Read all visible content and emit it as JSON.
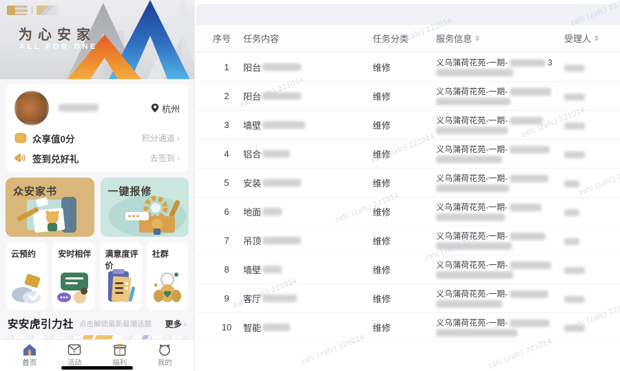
{
  "app": {
    "banner": {
      "title": "为心安家",
      "subtitle": "ALL FOR ONE"
    },
    "profile": {
      "location": "杭州",
      "points_label": "众享值0分",
      "points_link": "积分通道",
      "signin_label": "签到兑好礼",
      "signin_link": "去签到"
    },
    "feature_cards": [
      {
        "label": "众安家书"
      },
      {
        "label": "一键报修"
      }
    ],
    "quick_actions": [
      {
        "label": "云预约"
      },
      {
        "label": "安时相伴"
      },
      {
        "label": "满意度评价"
      },
      {
        "label": "社群"
      }
    ],
    "community": {
      "title": "安安虎引力社",
      "subtitle": "点击解锁最新最潮话题",
      "more": "更多"
    },
    "tabbar": [
      {
        "label": "首页",
        "active": true
      },
      {
        "label": "活动",
        "active": false
      },
      {
        "label": "福利",
        "active": false
      },
      {
        "label": "我的",
        "active": false
      }
    ]
  },
  "table": {
    "headers": [
      {
        "label": "序号",
        "sortable": false
      },
      {
        "label": "任务内容",
        "sortable": false
      },
      {
        "label": "任务分类",
        "sortable": false
      },
      {
        "label": "服务信息",
        "sortable": true
      },
      {
        "label": "受理人",
        "sortable": true
      }
    ],
    "rows": [
      {
        "no": "1",
        "task": "阳台",
        "category": "维修",
        "service": "义乌蒲荷花苑-一期-",
        "service_tail": "3",
        "blur": {
          "task": 56,
          "service1": 52,
          "service2": 112,
          "handler": 30
        }
      },
      {
        "no": "2",
        "task": "阳台",
        "category": "维修",
        "service": "义乌蒲荷花苑-一期-",
        "service_tail": "",
        "blur": {
          "task": 56,
          "service1": 60,
          "service2": 108,
          "handler": 30
        }
      },
      {
        "no": "3",
        "task": "墙壁",
        "category": "维修",
        "service": "义乌蒲荷花苑-一期-",
        "service_tail": "",
        "blur": {
          "task": 62,
          "service1": 48,
          "service2": 104,
          "handler": 30
        }
      },
      {
        "no": "4",
        "task": "铝合",
        "category": "维修",
        "service": "义乌蒲荷花苑-一期-",
        "service_tail": "",
        "blur": {
          "task": 40,
          "service1": 58,
          "service2": 96,
          "handler": 30
        }
      },
      {
        "no": "5",
        "task": "安装",
        "category": "维修",
        "service": "义乌蒲荷花苑-一期-",
        "service_tail": "",
        "blur": {
          "task": 56,
          "service1": 56,
          "service2": 106,
          "handler": 22
        }
      },
      {
        "no": "6",
        "task": "地面",
        "category": "维修",
        "service": "义乌蒲荷花苑-一期-",
        "service_tail": "",
        "blur": {
          "task": 28,
          "service1": 46,
          "service2": 100,
          "handler": 22
        }
      },
      {
        "no": "7",
        "task": "吊顶",
        "category": "维修",
        "service": "义乌蒲荷花苑-一期-",
        "service_tail": "",
        "blur": {
          "task": 56,
          "service1": 52,
          "service2": 110,
          "handler": 22
        }
      },
      {
        "no": "8",
        "task": "墙壁",
        "category": "维修",
        "service": "义乌蒲荷花苑-一期-",
        "service_tail": "",
        "blur": {
          "task": 28,
          "service1": 60,
          "service2": 112,
          "handler": 30
        }
      },
      {
        "no": "9",
        "task": "客厅",
        "category": "维修",
        "service": "义乌蒲荷花苑-一期-",
        "service_tail": "",
        "blur": {
          "task": 50,
          "service1": 56,
          "service2": 96,
          "handler": 30
        }
      },
      {
        "no": "10",
        "task": "智能",
        "category": "维修",
        "service": "义乌蒲荷花苑-一期-",
        "service_tail": "",
        "blur": {
          "task": 40,
          "service1": 58,
          "service2": 118,
          "handler": 30
        }
      }
    ]
  },
  "watermark": "zafc (zafc) 221014",
  "colors": {
    "accent_blue": "#2f6fc0",
    "accent_orange": "#e8632a",
    "gold": "#d9a33c",
    "teal": "#7fbfb3"
  }
}
